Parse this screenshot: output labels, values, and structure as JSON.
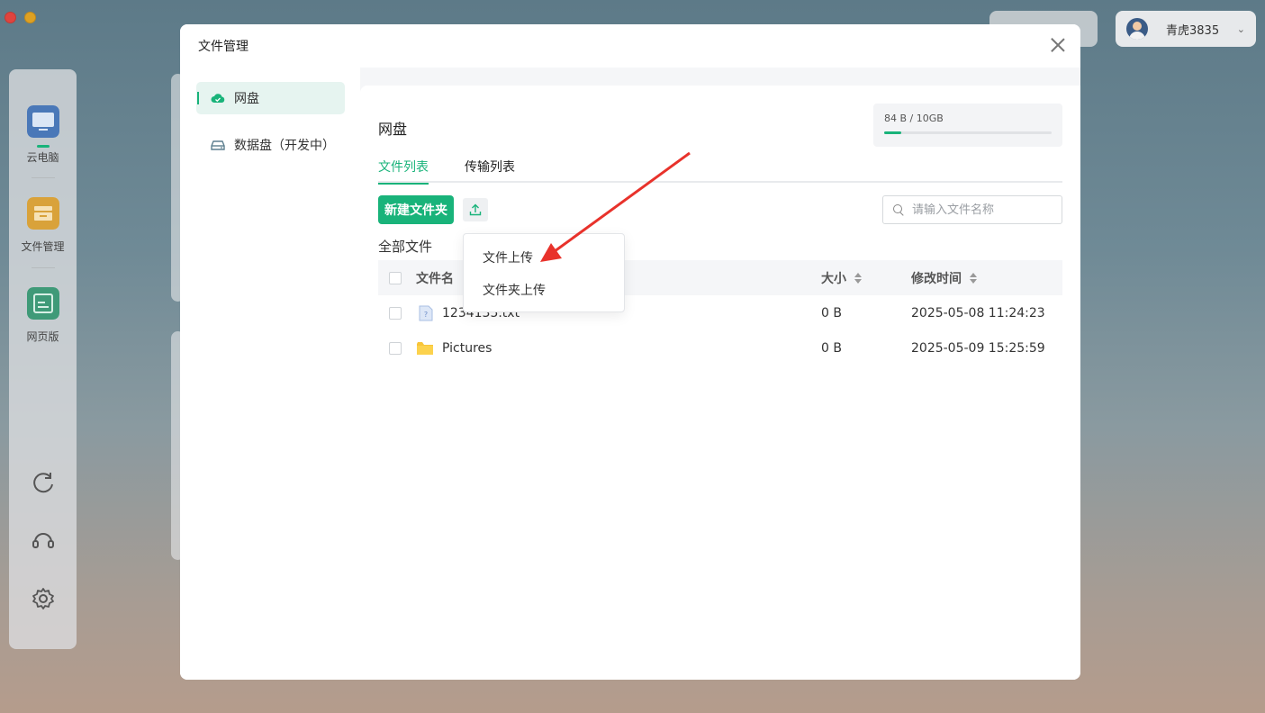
{
  "window": {
    "user_name": "青虎3835"
  },
  "rail": {
    "items": [
      {
        "label": "云电脑"
      },
      {
        "label": "文件管理"
      },
      {
        "label": "网页版"
      }
    ]
  },
  "modal": {
    "title": "文件管理",
    "nav": [
      {
        "label": "网盘",
        "active": true
      },
      {
        "label": "数据盘（开发中）",
        "active": false
      }
    ],
    "main": {
      "title": "网盘",
      "storage": {
        "text": "84 B / 10GB",
        "used_fraction": 0.1
      },
      "tabs": [
        {
          "label": "文件列表",
          "active": true
        },
        {
          "label": "传输列表",
          "active": false
        }
      ],
      "new_folder_label": "新建文件夹",
      "search_placeholder": "请输入文件名称",
      "breadcrumb": "全部文件",
      "table": {
        "columns": [
          "文件名",
          "大小",
          "修改时间"
        ],
        "rows": [
          {
            "name": "1234135.txt",
            "size": "0 B",
            "modified": "2025-05-08 11:24:23",
            "icon": "text-file-icon"
          },
          {
            "name": "Pictures",
            "size": "0 B",
            "modified": "2025-05-09 15:25:59",
            "icon": "folder-icon"
          }
        ]
      },
      "upload_menu": [
        "文件上传",
        "文件夹上传"
      ]
    }
  },
  "colors": {
    "accent": "#19b37a",
    "annotation_arrow": "#e8322b"
  }
}
